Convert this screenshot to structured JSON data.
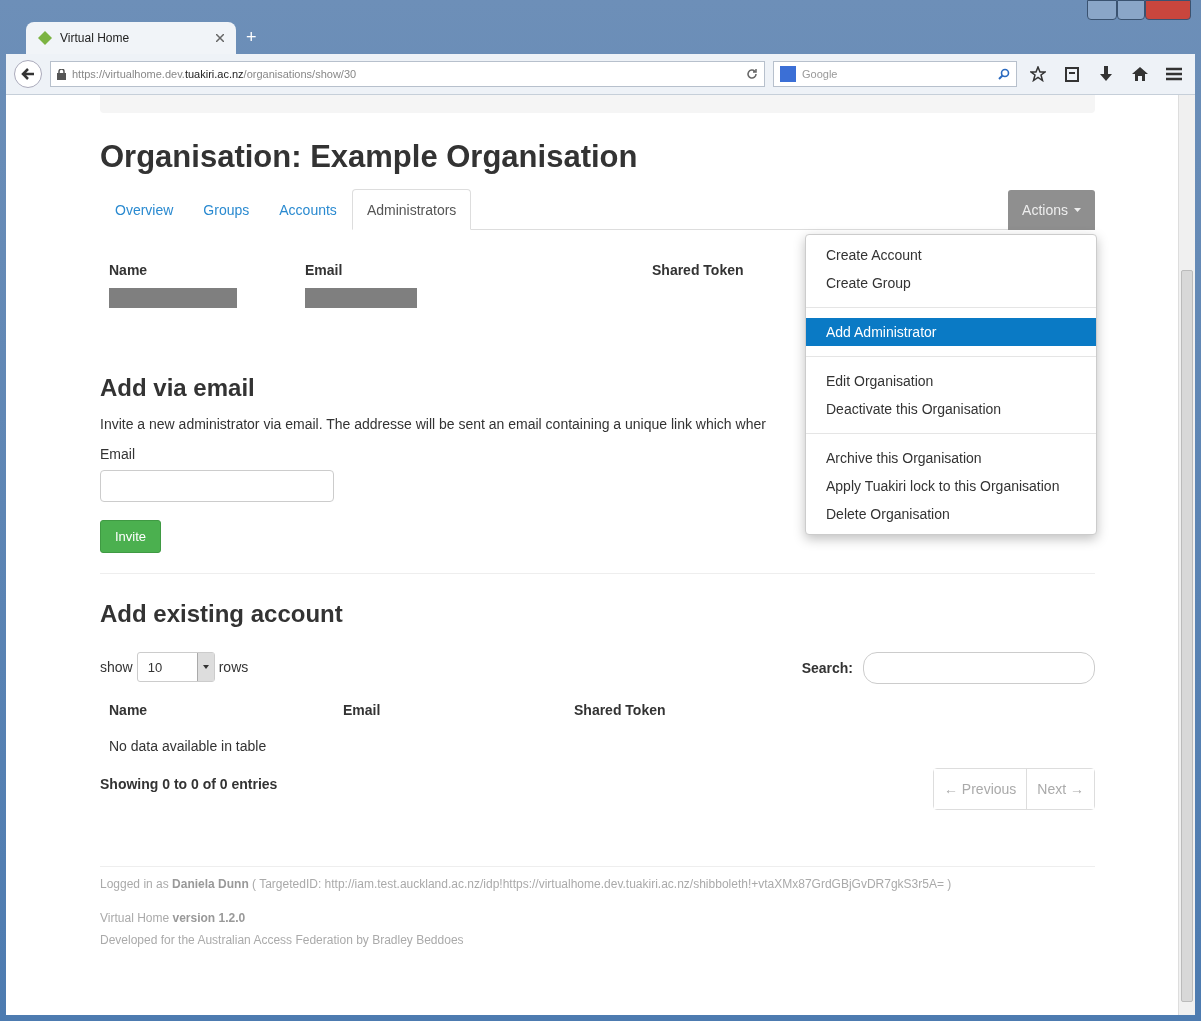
{
  "browser": {
    "tab_title": "Virtual Home",
    "new_tab": "+",
    "url": "https://virtualhome.dev.**tuakiri.ac.nz**/organisations/show/30",
    "search_placeholder": "Google"
  },
  "page": {
    "title": "Organisation: Example Organisation",
    "tabs": [
      {
        "label": "Overview",
        "selected": false
      },
      {
        "label": "Groups",
        "selected": false
      },
      {
        "label": "Accounts",
        "selected": false
      },
      {
        "label": "Administrators",
        "selected": true
      }
    ],
    "actions": {
      "label": "Actions",
      "expanded": true,
      "groups": [
        [
          {
            "label": "Create Account",
            "selected": false
          },
          {
            "label": "Create Group",
            "selected": false
          }
        ],
        [
          {
            "label": "Add Administrator",
            "selected": true
          }
        ],
        [
          {
            "label": "Edit Organisation",
            "selected": false
          },
          {
            "label": "Deactivate this Organisation",
            "selected": false
          }
        ],
        [
          {
            "label": "Archive this Organisation",
            "selected": false
          },
          {
            "label": "Apply Tuakiri lock to this Organisation",
            "selected": false
          },
          {
            "label": "Delete Organisation",
            "selected": false
          }
        ]
      ]
    },
    "admins_table": {
      "columns": [
        "Name",
        "Email",
        "Shared Token"
      ],
      "rows": [
        {
          "redacted": true
        }
      ]
    },
    "add_via_email": {
      "heading": "Add via email",
      "description": "Invite a new administrator via email. The addresse will be sent an email containing a unique link which wher",
      "email_label": "Email",
      "button": "Invite"
    },
    "add_existing": {
      "heading": "Add existing account",
      "show_label": "show",
      "page_size": "10",
      "rows_label": "rows",
      "search_label": "Search:",
      "columns": [
        "Name",
        "Email",
        "Shared Token"
      ],
      "empty": "No data available in table",
      "info": "Showing 0 to 0 of 0 entries",
      "previous": "← Previous",
      "next": "Next →"
    },
    "footer": {
      "login": "Logged in as **Daniela Dunn** ( TargetedID: http://iam.test.auckland.ac.nz/idp!https://virtualhome.dev.tuakiri.ac.nz/shibboleth!+vtaXMx87GrdGBjGvDR7gkS3r5A= )",
      "version": "Virtual Home **version 1.2.0**",
      "credit": "Developed for the Australian Access Federation by Bradley Beddoes"
    }
  }
}
